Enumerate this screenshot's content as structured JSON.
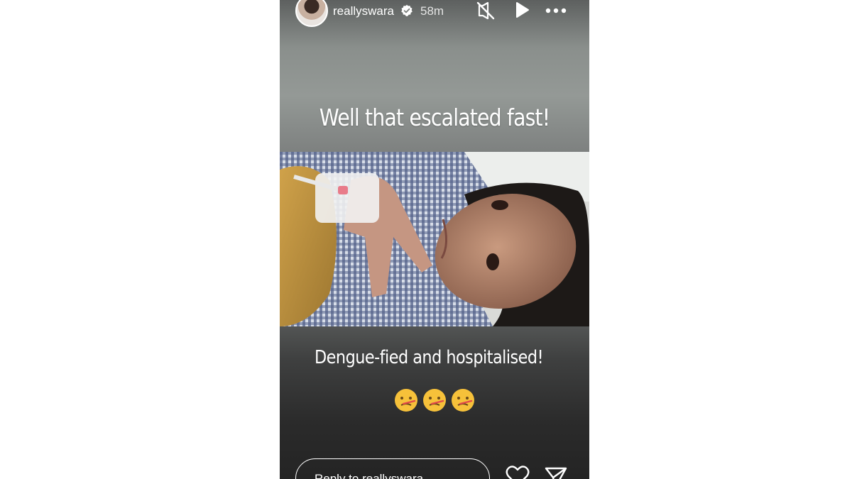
{
  "story": {
    "username": "reallyswara",
    "verified": true,
    "time_ago": "58m",
    "caption_top": "Well that escalated fast!",
    "caption_bottom": "Dengue-fied and hospitalised!",
    "emojis": [
      "🤒",
      "🤒",
      "🤒"
    ],
    "reply_placeholder": "Reply to reallyswara..."
  },
  "icons": {
    "mute": "muted-speaker-icon",
    "play": "play-icon",
    "more": "more-options-icon",
    "like": "heart-icon",
    "share": "send-icon"
  },
  "colors": {
    "text": "#ffffff",
    "background_top": "#8a8f8c",
    "background_bottom": "#242424"
  }
}
